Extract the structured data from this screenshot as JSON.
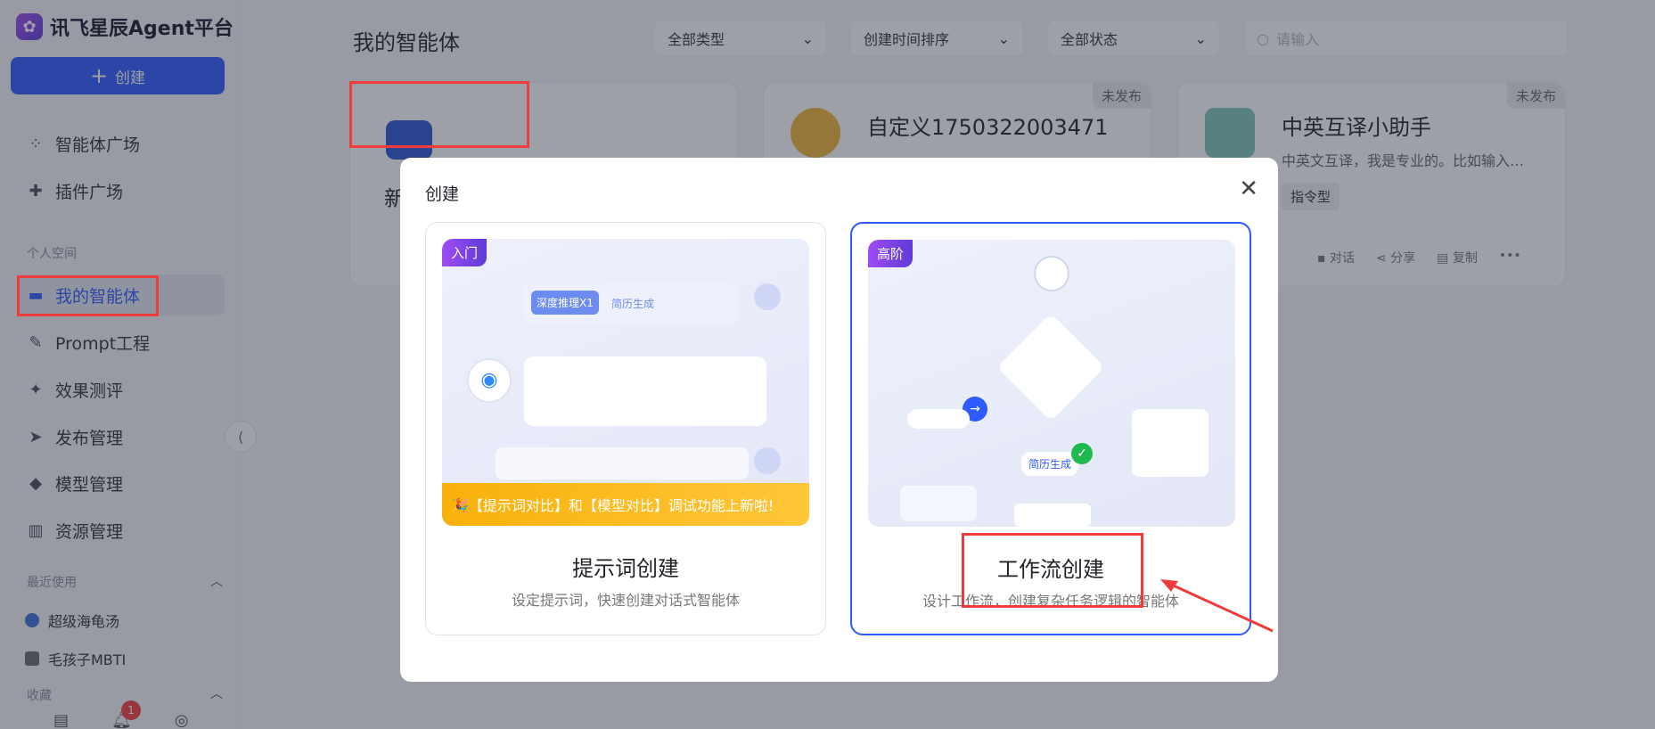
{
  "app": {
    "title": "讯飞星辰Agent平台"
  },
  "sidebar": {
    "create_label": "创建",
    "items_top": [
      {
        "label": "智能体广场",
        "icon": "grid-icon"
      },
      {
        "label": "插件广场",
        "icon": "puzzle-icon"
      }
    ],
    "personal_label": "个人空间",
    "items_personal": [
      {
        "label": "我的智能体",
        "icon": "folder-icon"
      },
      {
        "label": "Prompt工程",
        "icon": "prompt-icon"
      },
      {
        "label": "效果测评",
        "icon": "sparkle-icon"
      },
      {
        "label": "发布管理",
        "icon": "send-icon"
      },
      {
        "label": "模型管理",
        "icon": "cube-icon"
      },
      {
        "label": "资源管理",
        "icon": "books-icon"
      }
    ],
    "recent_label": "最近使用",
    "recent": [
      {
        "label": "超级海龟汤"
      },
      {
        "label": "毛孩子MBTI"
      }
    ],
    "favorites_label": "收藏",
    "notification_count": "1"
  },
  "main": {
    "title": "我的智能体",
    "filters": [
      {
        "value": "全部类型"
      },
      {
        "value": "创建时间排序"
      },
      {
        "value": "全部状态"
      }
    ],
    "search_placeholder": "请输入",
    "cards": [
      {
        "title": "新",
        "tag": ""
      },
      {
        "title": "自定义1750322003471",
        "tag": "未发布"
      },
      {
        "title": "中英互译小助手",
        "tag": "未发布",
        "desc": "中英文互译，我是专业的。比如输入…",
        "pill": "指令型",
        "actions": [
          "对话",
          "分享",
          "复制"
        ]
      }
    ]
  },
  "modal": {
    "title": "创建",
    "options": [
      {
        "badge": "入门",
        "title": "提示词创建",
        "desc": "设定提示词，快速创建对话式智能体",
        "illus_chip1": "深度推理X1",
        "illus_chip2": "简历生成",
        "banner": "🎉【提示词对比】和【模型对比】调试功能上新啦!"
      },
      {
        "badge": "高阶",
        "title": "工作流创建",
        "desc": "设计工作流，创建复杂任务逻辑的智能体",
        "illus_chip": "简历生成"
      }
    ]
  },
  "colors": {
    "accent": "#2e5bff",
    "highlight": "#ef3b3b"
  }
}
